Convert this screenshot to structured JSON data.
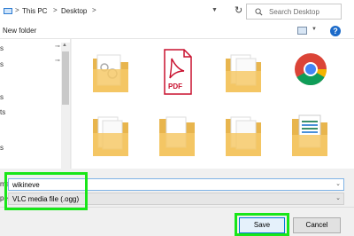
{
  "address_bar": {
    "crumbs": [
      "This PC",
      "Desktop"
    ],
    "separators": [
      ">",
      ">",
      ">"
    ],
    "dropdown_icon": "chevron-down-icon",
    "refresh_icon": "refresh-icon"
  },
  "search": {
    "placeholder": "Search Desktop",
    "icon": "search-icon"
  },
  "toolbar": {
    "new_folder_label": "New folder",
    "view_icon": "view-options-icon",
    "help_label": "?"
  },
  "nav_pane": {
    "items": [
      "s",
      "s",
      "s",
      "ts",
      "s"
    ],
    "pin_glyph": "⊸"
  },
  "files": [
    {
      "icon": "folder-icon",
      "variant": "gears"
    },
    {
      "icon": "pdf-file-icon",
      "label": "PDF"
    },
    {
      "icon": "folder-icon",
      "variant": "documents"
    },
    {
      "icon": "chrome-icon"
    },
    {
      "icon": "folder-icon",
      "variant": "documents"
    },
    {
      "icon": "folder-icon",
      "variant": "documents"
    },
    {
      "icon": "folder-icon",
      "variant": "documents"
    },
    {
      "icon": "folder-icon",
      "variant": "spreadsheet"
    }
  ],
  "save_form": {
    "filename_label": "me:",
    "filename_value": "wikineve",
    "filetype_label": "pe:",
    "filetype_value": "VLC media file (.ogg)"
  },
  "buttons": {
    "save": "Save",
    "cancel": "Cancel"
  },
  "colors": {
    "highlight": "#19e619",
    "accent": "#0078d7",
    "folder": "#f6c969",
    "pdf_red": "#c8102e"
  }
}
